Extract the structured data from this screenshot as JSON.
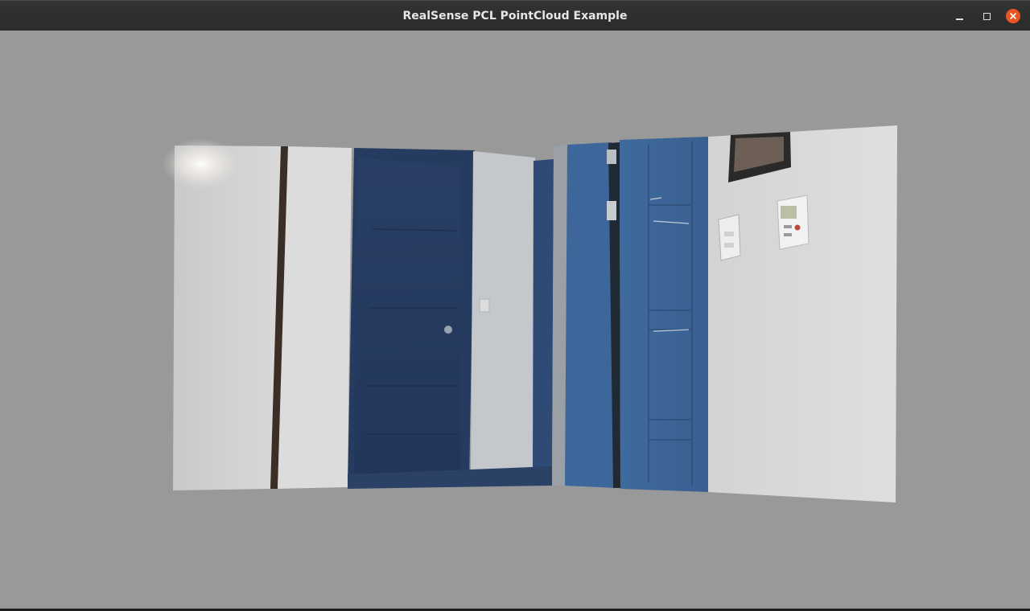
{
  "window": {
    "title": "RealSense PCL PointCloud Example"
  },
  "controls": {
    "minimize_icon": "minimize-icon",
    "maximize_icon": "maximize-icon",
    "close_icon": "close-icon",
    "close_color": "#e95420"
  },
  "viewport": {
    "background_color": "#999999"
  }
}
